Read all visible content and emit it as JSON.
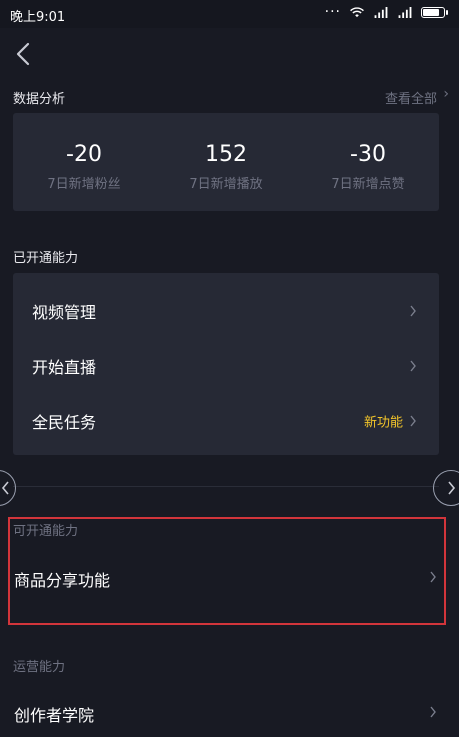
{
  "status_bar": {
    "time": "晚上9:01"
  },
  "data_analysis": {
    "title": "数据分析",
    "view_all": "查看全部",
    "stats": [
      {
        "value": "-20",
        "label": "7日新增粉丝"
      },
      {
        "value": "152",
        "label": "7日新增播放"
      },
      {
        "value": "-30",
        "label": "7日新增点赞"
      }
    ]
  },
  "enabled_capabilities": {
    "title": "已开通能力",
    "items": [
      {
        "label": "视频管理"
      },
      {
        "label": "开始直播"
      },
      {
        "label": "全民任务",
        "badge": "新功能"
      }
    ]
  },
  "available_capabilities": {
    "title": "可开通能力",
    "items": [
      {
        "label": "商品分享功能"
      }
    ]
  },
  "operations": {
    "title": "运营能力",
    "items": [
      {
        "label": "创作者学院"
      }
    ]
  },
  "colors": {
    "background": "#181a23",
    "card": "#262935",
    "muted_text": "#6f7282",
    "badge": "#f3c52a",
    "highlight": "#d2353b"
  }
}
